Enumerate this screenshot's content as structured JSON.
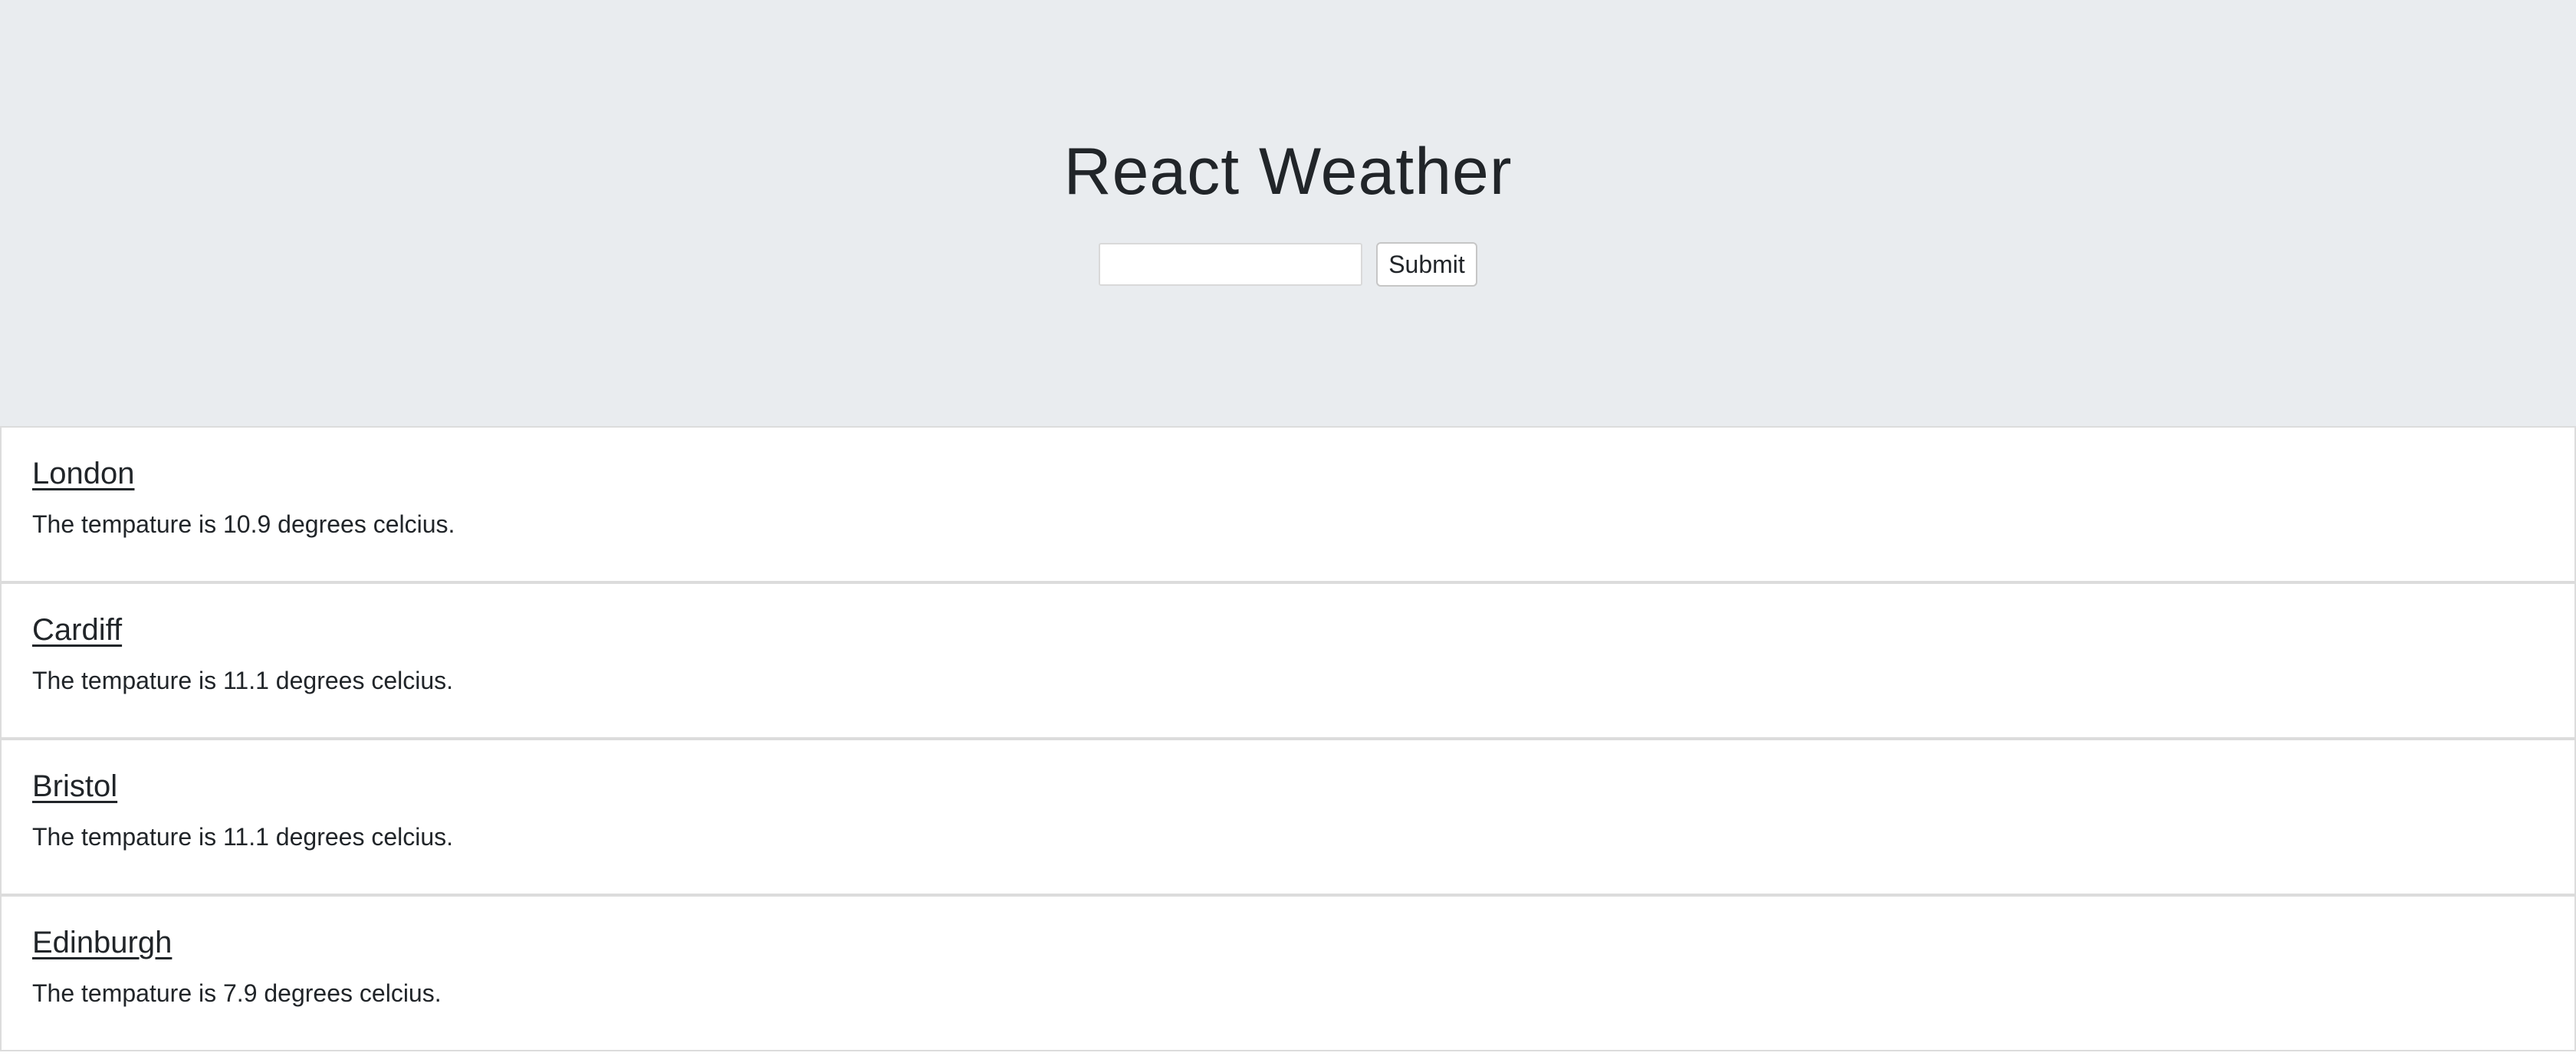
{
  "header": {
    "title": "React Weather",
    "search": {
      "value": "",
      "placeholder": ""
    },
    "submit_label": "Submit"
  },
  "cities": [
    {
      "name": "London",
      "temperature_text": "The tempature is 10.9 degrees celcius."
    },
    {
      "name": "Cardiff",
      "temperature_text": "The tempature is 11.1 degrees celcius."
    },
    {
      "name": "Bristol",
      "temperature_text": "The tempature is 11.1 degrees celcius."
    },
    {
      "name": "Edinburgh",
      "temperature_text": "The tempature is 7.9 degrees celcius."
    }
  ],
  "colors": {
    "header_background": "#e9ecef",
    "text": "#212529",
    "card_border": "#dcdcdc"
  }
}
